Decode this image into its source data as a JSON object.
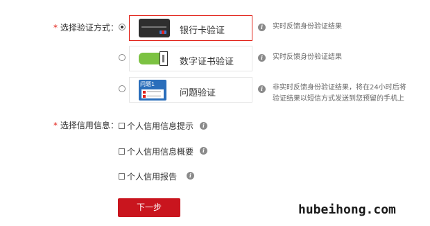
{
  "verification": {
    "label_star": "*",
    "label": "选择验证方式：",
    "options": [
      {
        "label": "银行卡验证",
        "selected": true,
        "desc": "实时反馈身份验证结果",
        "icon": "bank-card-icon"
      },
      {
        "label": "数字证书验证",
        "selected": false,
        "desc": "实时反馈身份验证结果",
        "icon": "usb-key-icon"
      },
      {
        "label": "问题验证",
        "selected": false,
        "desc_line1": "非实时反馈身份验证结果，将在24小时后将",
        "desc_line2": "验证结果以短信方式发送到您预留的手机上",
        "icon": "question-card-icon",
        "icon_text": "问题1"
      }
    ]
  },
  "credit_info": {
    "label_star": "*",
    "label": "选择信用信息：",
    "items": [
      {
        "label": "个人信用信息提示",
        "checked": false
      },
      {
        "label": "个人信用信息概要",
        "checked": false
      },
      {
        "label": "个人信用报告",
        "checked": false
      }
    ]
  },
  "next_button": {
    "label": "下一步"
  },
  "watermark": "hubeihong.com",
  "colors": {
    "accent": "#c9151e",
    "required_star": "#e2231a"
  }
}
